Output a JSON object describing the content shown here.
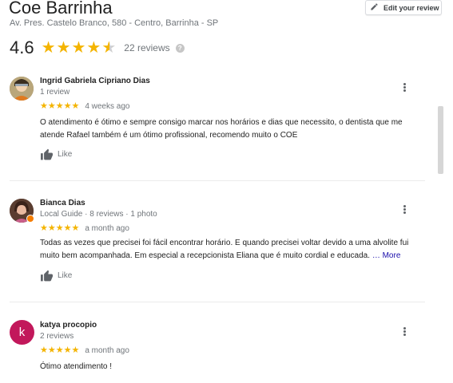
{
  "place": {
    "name": "Coe Barrinha",
    "address": "Av. Pres. Castelo Branco, 580 - Centro, Barrinha - SP",
    "edit_review_label": "Edit your review",
    "rating": "4.6",
    "reviews_count": "22 reviews",
    "help_glyph": "?"
  },
  "star_glyph": "★",
  "reviews": [
    {
      "name": "Ingrid Gabriela Cipriano Dias",
      "meta": "1 review",
      "stars": "★★★★★",
      "time": "4 weeks ago",
      "text": "O atendimento é ótimo e sempre consigo marcar nos horários e dias que necessito, o dentista que me atende Rafael também é um ótimo profissional, recomendo muito o COE",
      "like": "Like"
    },
    {
      "name": "Bianca Dias",
      "meta": "Local Guide · 8 reviews · 1 photo",
      "stars": "★★★★★",
      "time": "a month ago",
      "text": "Todas as vezes que precisei foi fácil encontrar horário. E quando precisei voltar devido a uma alvolite fui muito bem acompanhada. Em especial a recepcionista Eliana que é muito cordial e educada. ",
      "more": "… More",
      "like": "Like"
    },
    {
      "name": "katya procopio",
      "meta": "2 reviews",
      "avatar_letter": "k",
      "stars": "★★★★★",
      "time": "a month ago",
      "text": "Ótimo atendimento !"
    }
  ],
  "colors": {
    "star": "#f4b400",
    "avatar_k": "#c2185b",
    "link": "#1a0dab"
  }
}
